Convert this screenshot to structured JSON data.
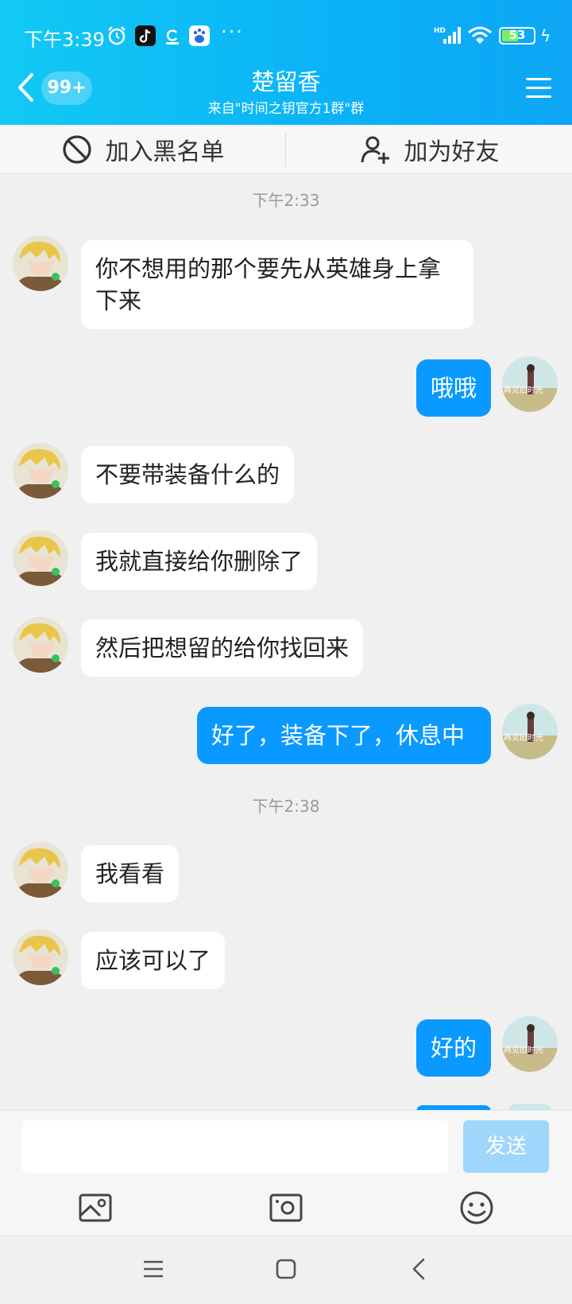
{
  "status_bar": {
    "time": "下午3:39",
    "dots": "···",
    "battery": "53",
    "battery_level": 0.53,
    "network": "HD"
  },
  "header": {
    "badge": "99+",
    "title": "楚留香",
    "subtitle": "来自\"时间之钥官方1群\"群"
  },
  "actions": {
    "blacklist": "加入黑名单",
    "add_friend": "加为好友"
  },
  "timestamps": [
    "下午2:33",
    "下午2:38"
  ],
  "messages": [
    {
      "side": "left",
      "text": "你不想用的那个要先从英雄身上拿下来"
    },
    {
      "side": "right",
      "text": "哦哦"
    },
    {
      "side": "left",
      "text": "不要带装备什么的"
    },
    {
      "side": "left",
      "text": "我就直接给你删除了"
    },
    {
      "side": "left",
      "text": "然后把想留的给你找回来"
    },
    {
      "side": "right",
      "text": "好了，装备下了，休息中"
    },
    {
      "side": "left",
      "text": "我看看"
    },
    {
      "side": "left",
      "text": "应该可以了"
    },
    {
      "side": "right",
      "text": "好的"
    }
  ],
  "avatar_watermark": "再见旧时光",
  "input": {
    "value": "",
    "send_label": "发送"
  },
  "colors": {
    "header_start": "#12c9f4",
    "header_end": "#0ea6f5",
    "bubble_self": "#0a99ff",
    "bubble_other": "#ffffff",
    "send_disabled": "#9fd6fb"
  }
}
